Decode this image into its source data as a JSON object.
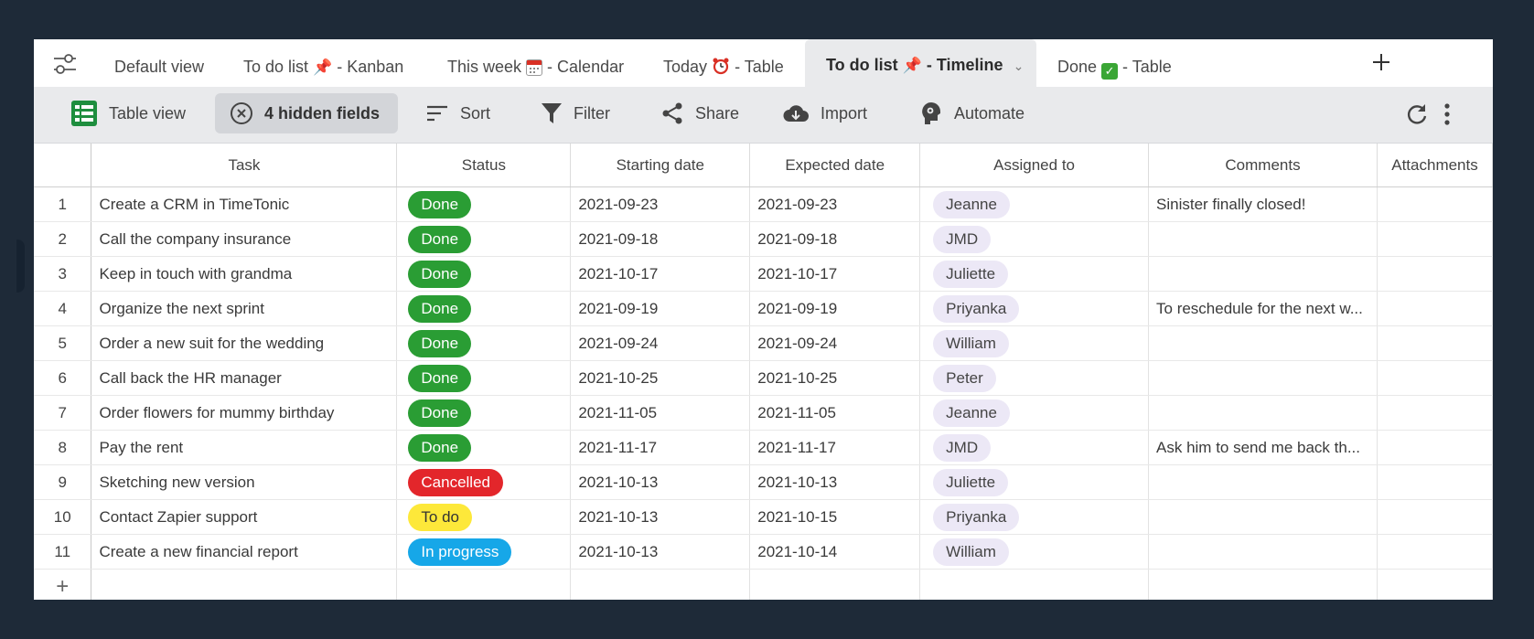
{
  "tabs": [
    {
      "label": "Default view",
      "emoji": "",
      "suffix": ""
    },
    {
      "label": "To do list",
      "emoji": "📌",
      "suffix": " - Kanban"
    },
    {
      "label": "This week",
      "emoji": "📅",
      "suffix": " - Calendar"
    },
    {
      "label": "Today",
      "emoji": "⏰",
      "suffix": " - Table"
    },
    {
      "label": "To do list",
      "emoji": "📌",
      "suffix": " - Timeline",
      "active": true
    },
    {
      "label": "Done",
      "emoji": "✓",
      "suffix": " - Table"
    }
  ],
  "toolbar": {
    "table_view": "Table view",
    "hidden_fields": "4 hidden fields",
    "sort": "Sort",
    "filter": "Filter",
    "share": "Share",
    "import": "Import",
    "automate": "Automate"
  },
  "columns": [
    "Task",
    "Status",
    "Starting date",
    "Expected date",
    "Assigned to",
    "Comments",
    "Attachments"
  ],
  "rows": [
    {
      "n": "1",
      "task": "Create a CRM in TimeTonic",
      "status": "Done",
      "start": "2021-09-23",
      "expected": "2021-09-23",
      "assigned": "Jeanne",
      "comment": "Sinister finally closed!"
    },
    {
      "n": "2",
      "task": "Call the company insurance",
      "status": "Done",
      "start": "2021-09-18",
      "expected": "2021-09-18",
      "assigned": "JMD",
      "comment": ""
    },
    {
      "n": "3",
      "task": "Keep in touch with grandma",
      "status": "Done",
      "start": "2021-10-17",
      "expected": "2021-10-17",
      "assigned": "Juliette",
      "comment": ""
    },
    {
      "n": "4",
      "task": "Organize the next sprint",
      "status": "Done",
      "start": "2021-09-19",
      "expected": "2021-09-19",
      "assigned": "Priyanka",
      "comment": "To reschedule for the next w..."
    },
    {
      "n": "5",
      "task": "Order a new suit for the wedding",
      "status": "Done",
      "start": "2021-09-24",
      "expected": "2021-09-24",
      "assigned": "William",
      "comment": ""
    },
    {
      "n": "6",
      "task": "Call back the HR manager",
      "status": "Done",
      "start": "2021-10-25",
      "expected": "2021-10-25",
      "assigned": "Peter",
      "comment": ""
    },
    {
      "n": "7",
      "task": "Order flowers for mummy birthday",
      "status": "Done",
      "start": "2021-11-05",
      "expected": "2021-11-05",
      "assigned": "Jeanne",
      "comment": ""
    },
    {
      "n": "8",
      "task": "Pay the rent",
      "status": "Done",
      "start": "2021-11-17",
      "expected": "2021-11-17",
      "assigned": "JMD",
      "comment": "Ask him to send me back th..."
    },
    {
      "n": "9",
      "task": "Sketching new version",
      "status": "Cancelled",
      "start": "2021-10-13",
      "expected": "2021-10-13",
      "assigned": "Juliette",
      "comment": ""
    },
    {
      "n": "10",
      "task": "Contact Zapier support",
      "status": "To do",
      "start": "2021-10-13",
      "expected": "2021-10-15",
      "assigned": "Priyanka",
      "comment": ""
    },
    {
      "n": "11",
      "task": "Create a new financial report",
      "status": "In progress",
      "start": "2021-10-13",
      "expected": "2021-10-14",
      "assigned": "William",
      "comment": ""
    }
  ],
  "status_colors": {
    "Done": "#2a9d34",
    "Cancelled": "#e3262b",
    "To do": "#fde83a",
    "In progress": "#16a7e8"
  },
  "add_row_symbol": "+"
}
